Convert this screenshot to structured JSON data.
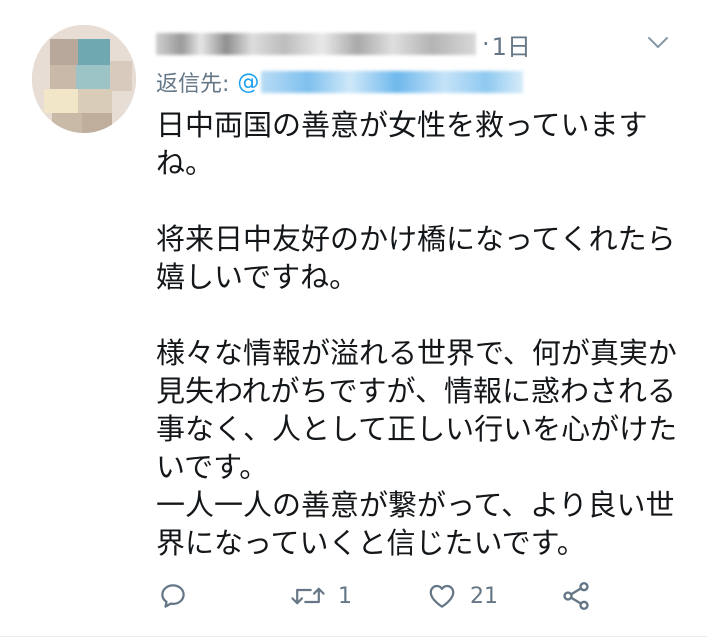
{
  "tweet": {
    "author_name": "",
    "separator": "·",
    "timestamp": "1日",
    "reply_label": "返信先:",
    "reply_at": "@",
    "paragraphs": [
      "日中両国の善意が女性を救っていますね。",
      "将来日中友好のかけ橋になってくれたら嬉しいですね。",
      "様々な情報が溢れる世界で、何が真実か見失われがちですが、情報に惑わされる事なく、人として正しい行いを心がけたいです。\n一人一人の善意が繋がって、より良い世界になっていくと信じたいです。"
    ],
    "actions": {
      "reply_icon": "reply-icon",
      "retweet_icon": "retweet-icon",
      "retweet_count": "1",
      "like_icon": "heart-icon",
      "like_count": "21",
      "share_icon": "share-icon"
    },
    "colors": {
      "text": "#14171a",
      "muted": "#657786",
      "accent": "#1da1f2",
      "divider": "#e6ecf0"
    }
  }
}
